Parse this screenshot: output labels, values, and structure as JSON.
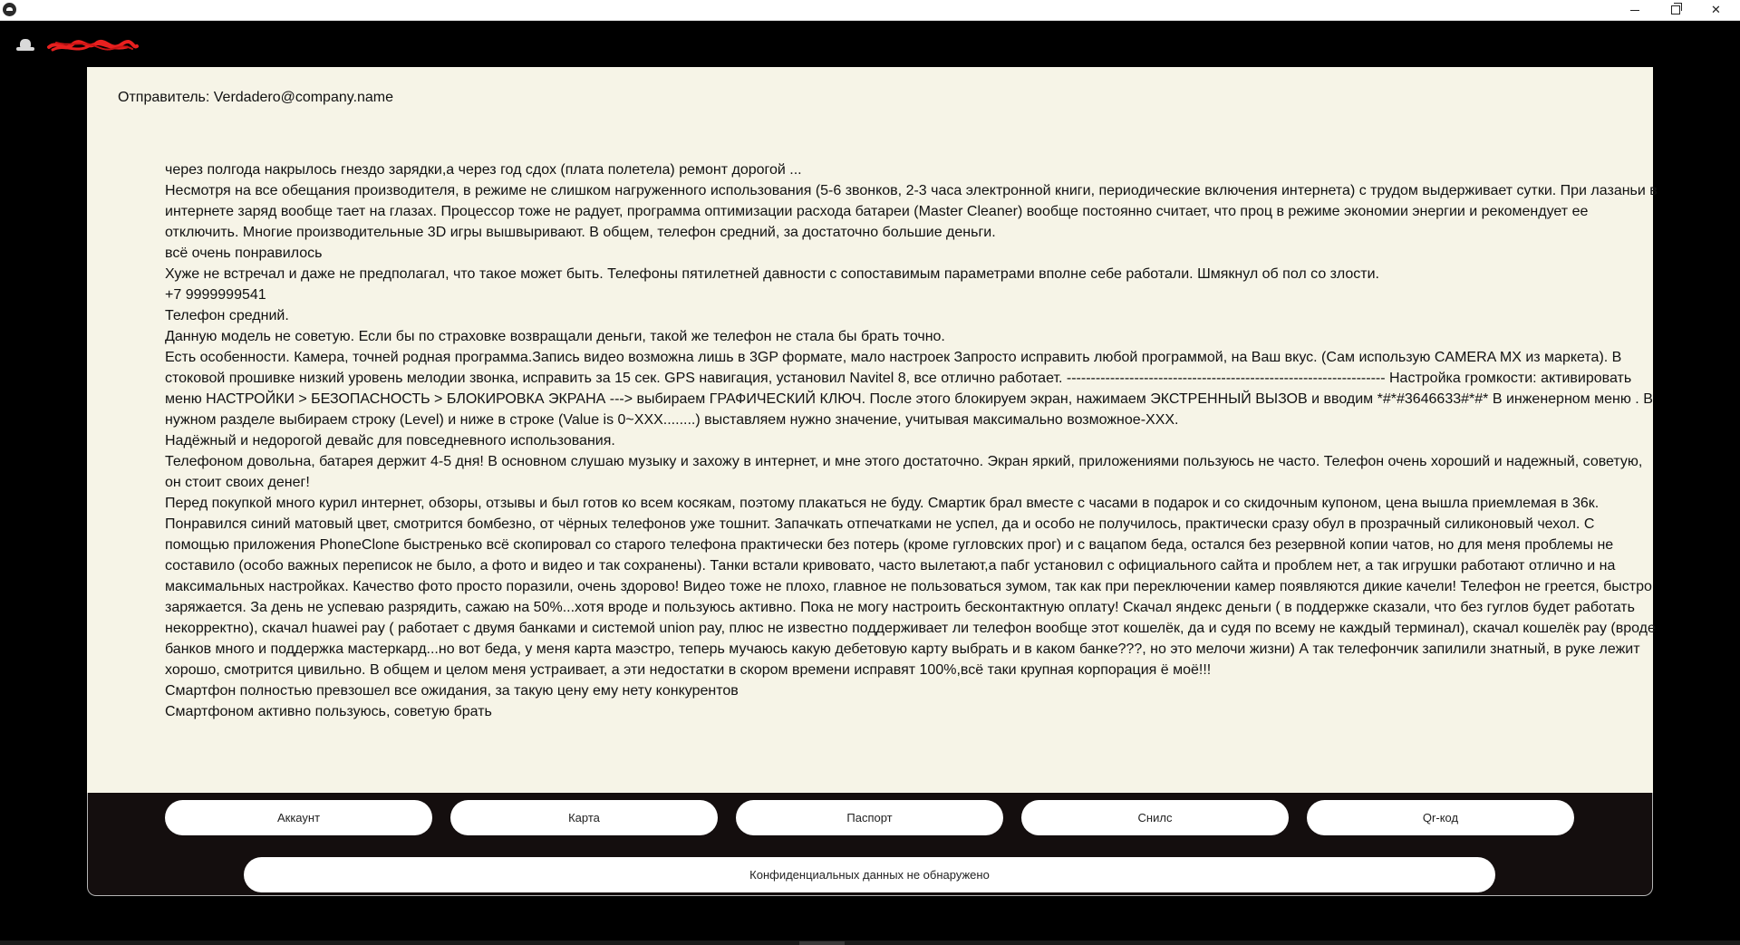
{
  "window": {
    "minimize_symbol": "",
    "close_symbol": "✕"
  },
  "sender": {
    "text": "Отправитель: Verdadero@company.name"
  },
  "reviews": [
    "через полгода накрылось гнездо зарядки,а через год сдох (плата полетела) ремонт дорогой ...",
    "Несмотря на все обещания производителя, в режиме не слишком нагруженного использования (5-6 звонков, 2-3 часа электронной книги, периодические включения интернета) с трудом выдерживает сутки. При лазаньи в интернете заряд вообще тает на глазах. Процессор тоже не радует, программа оптимизации расхода батареи (Master Cleaner) вообще постоянно считает, что проц в режиме экономии энергии и рекомендует ее отключить. Многие производительные 3D игры вышвыривают. В общем, телефон средний, за достаточно большие деньги.",
    "всё очень понравилось",
    "Хуже не встречал и даже не предполагал, что такое может быть. Телефоны пятилетней давности с сопоставимым параметрами вполне себе работали. Шмякнул об пол со злости.",
    "+7 9999999541",
    "Телефон средний.",
    "Данную модель не советую. Если бы по страховке возвращали деньги, такой же телефон не стала бы брать точно.",
    "Есть особенности. Камера, точней родная программа.Запись видео возможна лишь в 3GP формате, мало настроек Запросто исправить любой программой, на Ваш вкус. (Сам использую CAMERA MX из маркета). В стоковой прошивке низкий уровень мелодии звонка, исправить за 15 сек. GPS навигация, установил Navitel 8, все отлично работает. ------------------------------------------------------------------ Настройка громкости: активировать меню НАСТРОЙКИ > БЕЗОПАСНОСТЬ > БЛОКИРОВКА ЭКРАНА ---> выбираем ГРАФИЧЕСКИЙ КЛЮЧ. После этого блокируем экран, нажимаем ЭКСТРЕННЫЙ ВЫЗОВ и вводим *#*#3646633#*#* В инженерном меню . В нужном разделе выбираем строку (Level) и ниже в строке (Value is 0~XXX........) выставляем нужно значение, учитывая максимально возможное-XXX.",
    "Надёжный и недорогой девайс для повседневного использования.",
    "Телефоном довольна, батарея держит 4-5 дня! В основном слушаю музыку и захожу в интернет, и мне этого достаточно. Экран яркий, приложениями пользуюсь не часто. Телефон очень хороший и надежный, советую, он стоит своих денег!",
    "Перед покупкой много курил интернет, обзоры, отзывы и был готов ко всем косякам, поэтому плакаться не буду. Смартик брал вместе с часами в подарок и со скидочным купоном, цена вышла приемлемая в 36к. Понравился синий матовый цвет, смотрится бомбезно, от чёрных телефонов уже тошнит. Запачкать отпечатками не успел, да и особо не получилось, практически сразу обул в прозрачный силиконовый чехол. С помощью приложения PhoneClone быстренько всё скопировал со старого телефона практически без потерь (кроме гугловских прог) и с вацапом беда, остался без резервной копии чатов, но для меня проблемы не составило (особо важных переписок не было, а фото и видео и так сохранены). Танки встали кривовато, часто вылетают,а пабг установил с официального сайта и проблем нет, а так игрушки работают отлично и на максимальных настройках. Качество фото просто поразили, очень здорово! Видео тоже не плохо, главное не пользоваться зумом, так как при переключении камер появляются дикие качели! Телефон не греется, быстро заряжается. За день не успеваю разрядить, сажаю на 50%...хотя вроде и пользуюсь активно. Пока не могу настроить бесконтактную оплату! Скачал яндекс деньги ( в поддержке сказали, что без гуглов будет работать некорректно), скачал huawei pay ( работает с двумя банками и системой union pay, плюс не известно поддерживает ли телефон вообще этот кошелёк, да и судя по всему не каждый терминал), скачал кошелёк pay (вроде банков много и поддержка мастеркард...но вот беда, у меня карта маэстро, теперь мучаюсь какую дебетовую карту выбрать и в каком банке???, но это мелочи жизни) А так телефончик запилили знатный, в руке лежит хорошо, смотрится цивильно. В общем и целом меня устраивает, а эти недостатки в скором времени исправят 100%,всё таки крупная корпорация ё моё!!!",
    "Смартфон полностью превзошел все ожидания, за такую цену ему нету конкурентов",
    "Смартфоном активно пользуюсь, советую брать"
  ],
  "buttons": {
    "account": "Аккаунт",
    "card": "Карта",
    "passport": "Паспорт",
    "snils": "Снилс",
    "qr": "Qr-код"
  },
  "status": {
    "text": "Конфиденциальных данных не обнаружено"
  },
  "colors": {
    "background": "#000000",
    "panel": "#f6f4e7",
    "action_panel": "#140e0e",
    "button": "#ffffff",
    "scribble": "#e8201f"
  },
  "icons": {
    "app": "app-icon",
    "hat": "hat-icon",
    "logo": "scribbled-logo",
    "minimize": "minimize-icon",
    "maximize": "restore-icon",
    "close": "close-icon"
  }
}
